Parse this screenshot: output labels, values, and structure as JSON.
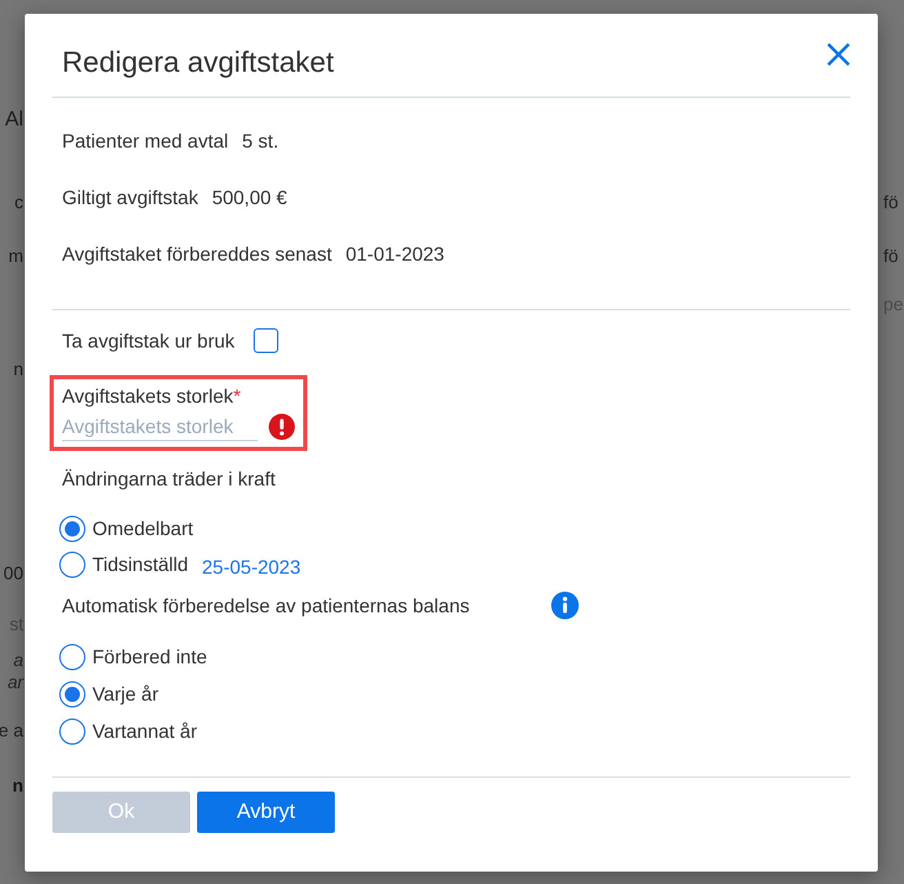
{
  "background": {
    "left_fragments": [
      {
        "text": "Al",
        "kind": "heading"
      },
      {
        "text": "c",
        "kind": "text"
      },
      {
        "text": "m",
        "kind": "text"
      },
      {
        "text": "n",
        "kind": "text"
      },
      {
        "text": "00",
        "kind": "text"
      },
      {
        "text": "st",
        "kind": "muted"
      },
      {
        "text": "a",
        "kind": "italic"
      },
      {
        "text": "ar",
        "kind": "italic"
      },
      {
        "text": "e a",
        "kind": "text"
      },
      {
        "text": "n",
        "kind": "bold"
      }
    ],
    "right_fragments": [
      {
        "text": "fö",
        "kind": "text"
      },
      {
        "text": "fö",
        "kind": "text"
      },
      {
        "text": "pe",
        "kind": "muted"
      }
    ]
  },
  "dialog": {
    "title": "Redigera avgiftstaket",
    "summary": [
      {
        "label": "Patienter med avtal",
        "value": "5 st."
      },
      {
        "label": "Giltigt avgiftstak",
        "value": "500,00 €"
      },
      {
        "label": "Avgiftstaket förbereddes senast",
        "value": "01-01-2023"
      }
    ],
    "disable_checkbox": {
      "label": "Ta avgiftstak ur bruk",
      "checked": false
    },
    "fee_field": {
      "label": "Avgiftstakets storlek",
      "required_mark": "*",
      "placeholder": "Avgiftstakets storlek",
      "error": true,
      "highlighted": true
    },
    "effective": {
      "label": "Ändringarna träder i kraft",
      "options": [
        {
          "label": "Omedelbart",
          "selected": true
        },
        {
          "label": "Tidsinställd",
          "selected": false,
          "date": "25-05-2023"
        }
      ]
    },
    "auto_prepare": {
      "label": "Automatisk förberedelse av patienternas balans",
      "info": true,
      "options": [
        {
          "label": "Förbered inte",
          "selected": false
        },
        {
          "label": "Varje år",
          "selected": true
        },
        {
          "label": "Vartannat år",
          "selected": false
        }
      ]
    },
    "buttons": [
      {
        "label": "Ok",
        "disabled": true
      },
      {
        "label": "Avbryt",
        "disabled": false
      }
    ]
  }
}
